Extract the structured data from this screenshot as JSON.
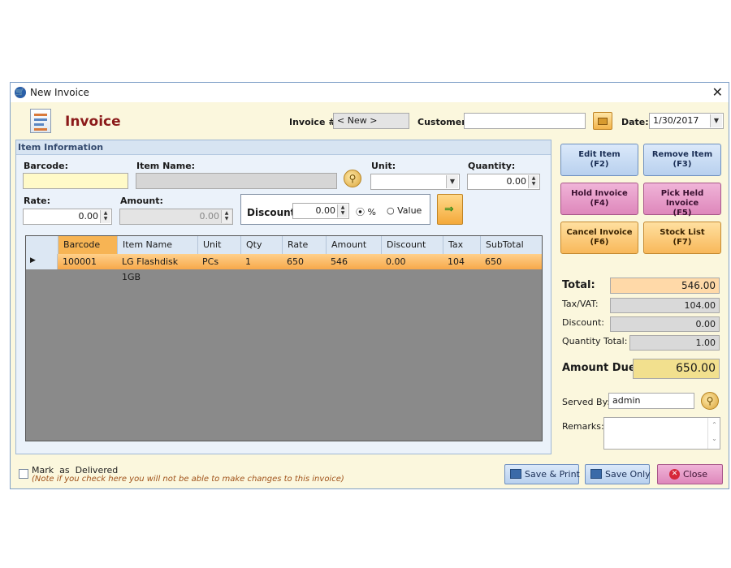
{
  "window": {
    "title": "New Invoice",
    "close_glyph": "✕"
  },
  "header": {
    "title": "Invoice",
    "invoice_no_label": "Invoice #:",
    "invoice_no_value": "< New >",
    "customer_label": "Customer:",
    "customer_value": "",
    "date_label": "Date:",
    "date_value": "1/30/2017"
  },
  "item_panel": {
    "title": "Item Information",
    "barcode_label": "Barcode:",
    "barcode_value": "",
    "item_name_label": "Item Name:",
    "item_name_value": "",
    "unit_label": "Unit:",
    "unit_value": "",
    "quantity_label": "Quantity:",
    "quantity_value": "0.00",
    "rate_label": "Rate:",
    "rate_value": "0.00",
    "amount_label": "Amount:",
    "amount_value": "0.00",
    "discount_label": "Discount:",
    "discount_value": "0.00",
    "percent_label": "%",
    "value_label": "Value",
    "discount_mode": "%"
  },
  "table": {
    "columns": [
      "Barcode",
      "Item Name",
      "Unit",
      "Qty",
      "Rate",
      "Amount",
      "Discount",
      "Tax",
      "SubTotal"
    ],
    "rows": [
      {
        "barcode": "100001",
        "item_name": "LG Flashdisk 1GB",
        "unit": "PCs",
        "qty": "1",
        "rate": "650",
        "amount": "546",
        "discount": "0.00",
        "tax": "104",
        "subtotal": "650"
      }
    ]
  },
  "actions": {
    "edit_item": "Edit Item",
    "edit_item_key": "(F2)",
    "remove_item": "Remove Item",
    "remove_item_key": "(F3)",
    "hold_invoice": "Hold Invoice",
    "hold_invoice_key": "(F4)",
    "pick_held_invoice": "Pick Held Invoice",
    "pick_held_invoice_key": "(F5)",
    "cancel_invoice": "Cancel Invoice",
    "cancel_invoice_key": "(F6)",
    "stock_list": "Stock List",
    "stock_list_key": "(F7)"
  },
  "totals": {
    "total_label": "Total:",
    "total_value": "546.00",
    "tax_label": "Tax/VAT:",
    "tax_value": "104.00",
    "discount_label": "Discount:",
    "discount_value": "0.00",
    "qty_total_label": "Quantity Total:",
    "qty_total_value": "1.00",
    "amount_due_label": "Amount Due:",
    "amount_due_value": "650.00"
  },
  "served_by": {
    "label": "Served By:",
    "value": "admin"
  },
  "remarks": {
    "label": "Remarks:",
    "value": ""
  },
  "footer": {
    "mark_delivered": "Mark  as  Delivered",
    "note": "(Note if you check here you will not be able to make changes to this invoice)",
    "save_print": "Save & Print",
    "save_only": "Save Only",
    "close": "Close"
  },
  "colors": {
    "accent_title": "#8b1a1a",
    "row_highlight": "#f7a84a",
    "amount_due_bg": "#f2e08e",
    "total_bg": "#ffd9a8"
  }
}
